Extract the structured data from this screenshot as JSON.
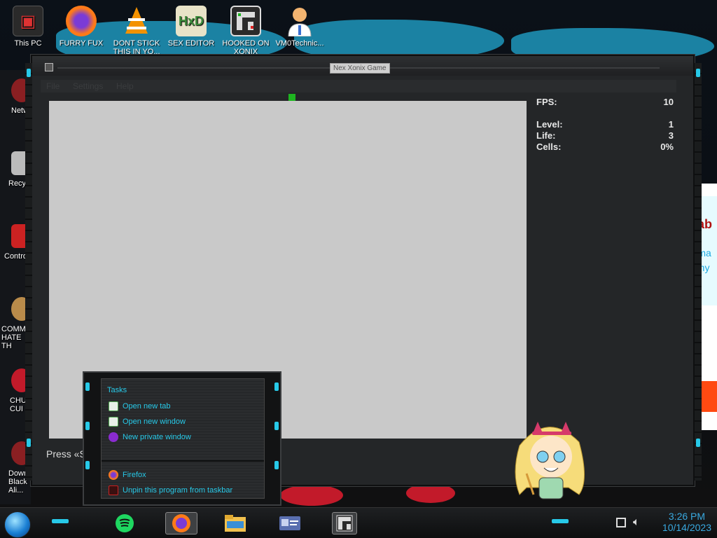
{
  "desktop": {
    "icons": [
      {
        "label": "This PC",
        "icon": "computer-icon"
      },
      {
        "label": "FURRY FUX",
        "icon": "firefox-icon"
      },
      {
        "label": "DONT STICK THIS IN YO...",
        "icon": "vlc-icon"
      },
      {
        "label": "SEX EDITOR",
        "icon": "hxd-icon"
      },
      {
        "label": "HOOKED ON XONIX",
        "icon": "xonix-icon"
      },
      {
        "label": "VM0Technic...",
        "icon": "doctor-icon"
      }
    ],
    "left_icons": [
      {
        "label": "Netw",
        "icon": "network-icon"
      },
      {
        "label": "Recycl",
        "icon": "recycle-bin-icon"
      },
      {
        "label": "Control",
        "icon": "control-panel-icon"
      },
      {
        "label": "COMMU HATE TH",
        "icon": "money-bag-icon"
      },
      {
        "label": "CHUZ CUI",
        "icon": "red-app-icon"
      },
      {
        "label": "Downl Black Ali...",
        "icon": "download-icon"
      }
    ]
  },
  "window": {
    "title": "Nex Xonix Game",
    "menu": [
      "File",
      "Settings",
      "Help"
    ],
    "stats": [
      {
        "label": "FPS:",
        "value": "10"
      },
      {
        "label": "Level:",
        "value": "1"
      },
      {
        "label": "Life:",
        "value": "3"
      },
      {
        "label": "Cells:",
        "value": "0%"
      }
    ],
    "status": "Press «S"
  },
  "background_page": {
    "line1": "atab",
    "line2": "forma",
    "line3": "if any"
  },
  "jumplist": {
    "heading": "Tasks",
    "tasks": [
      {
        "label": "Open new tab",
        "icon": "new-tab-icon"
      },
      {
        "label": "Open new window",
        "icon": "new-window-icon"
      },
      {
        "label": "New private window",
        "icon": "private-window-icon"
      }
    ],
    "pinned": [
      {
        "label": "Firefox",
        "icon": "firefox-icon"
      },
      {
        "label": "Unpin this program from taskbar",
        "icon": "unpin-icon"
      }
    ]
  },
  "taskbar": {
    "apps": [
      "spotify-icon",
      "firefox-icon",
      "file-explorer-icon",
      "id-card-icon",
      "xonix-icon"
    ],
    "time": "3:26 PM",
    "date": "10/14/2023"
  },
  "colors": {
    "accent": "#27c9e8",
    "playfield": "#c9c9c9",
    "player": "#1eb520",
    "clock": "#39a9e0"
  }
}
